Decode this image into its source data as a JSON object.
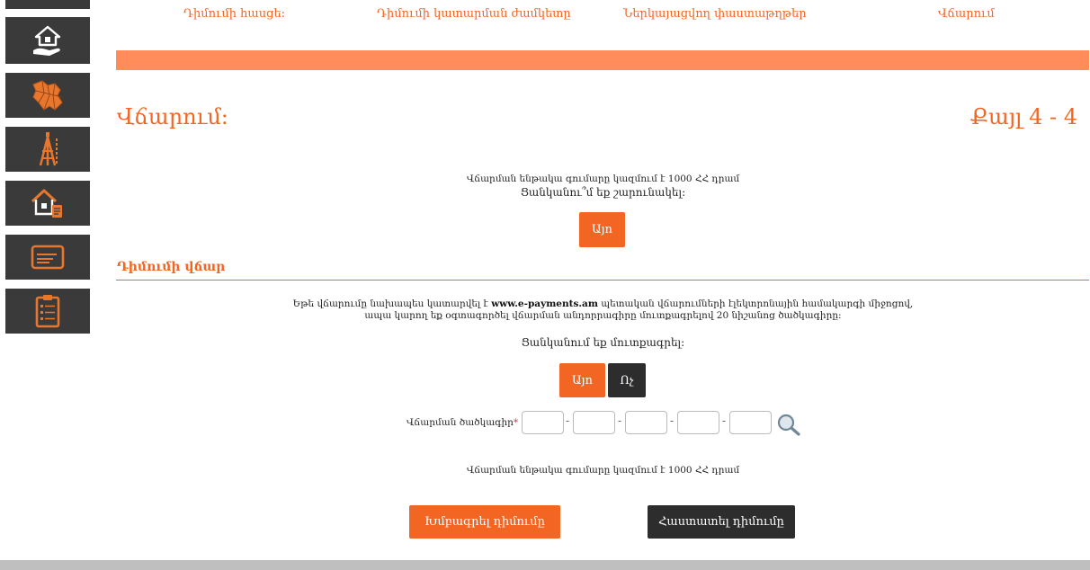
{
  "sidebar": {
    "items": [
      {
        "icon": "home-hand-icon"
      },
      {
        "icon": "map-icon"
      },
      {
        "icon": "survey-tower-icon"
      },
      {
        "icon": "house-document-icon"
      },
      {
        "icon": "card-document-icon"
      },
      {
        "icon": "clipboard-list-icon"
      }
    ]
  },
  "nav": {
    "items": [
      "Դիմումի հասցե:",
      "Դիմումի կատարման ժամկետը",
      "Ներկայացվող փաստաթղթեր",
      "Վճարում"
    ]
  },
  "page": {
    "title": "Վճարում:",
    "step": "Քայլ 4 - 4"
  },
  "payment": {
    "total_text": "Վճարման ենթակա գումարը կազմում է 1000 ՀՀ դրամ",
    "continue_question": "Ցանկանու՞մ եք շարունակել:",
    "yes_label": "Այո"
  },
  "fee": {
    "section_title": "Դիմումի վճար",
    "info_line1_pre": "Եթե վճարումը նախապես կատարվել է ",
    "info_link": "www.e-payments.am",
    "info_line1_post": " պետական վճարումների էլեկտրոնային համակարգի միջոցով,",
    "info_line2": "ապա կարող եք օգտագործել վճարման անդորրագիրը մուտքագրելով 20 նիշանոց ծածկագիրը:",
    "enter_question": "Ցանկանում եք մուտքագրել:",
    "yes_label": "Այո",
    "no_label": "Ոչ",
    "code_label": "Վճարման ծածկագիր",
    "required_mark": "*",
    "code_separator": "-",
    "total_text": "Վճարման ենթակա գումարը կազմում է 1000 ՀՀ դրամ"
  },
  "actions": {
    "edit_label": "Խմբագրել դիմումը",
    "confirm_label": "Հաստատել դիմումը"
  },
  "colors": {
    "accent": "#f26522",
    "bar": "#ff8c5a",
    "dark": "#2d2d2d",
    "sidebar": "#3a3a3a"
  }
}
